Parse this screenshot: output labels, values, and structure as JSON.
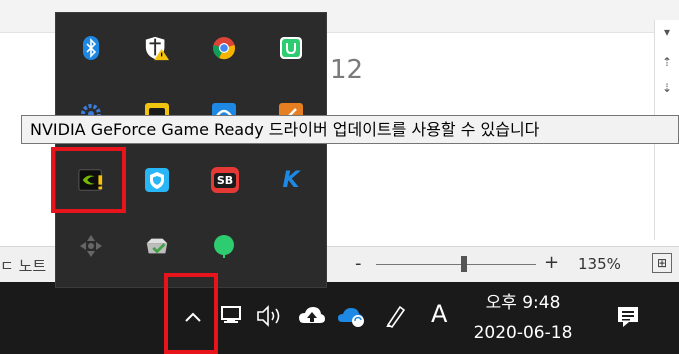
{
  "document": {
    "visible_number": "12",
    "status_left": "ㄷ 노트"
  },
  "status_bar": {
    "zoom_minus": "-",
    "zoom_plus": "+",
    "zoom_percent": "135%",
    "zoom_level": 0.55
  },
  "tooltip": {
    "text": "NVIDIA GeForce Game Ready 드라이버 업데이트를 사용할 수 있습니다"
  },
  "tray_icons": [
    {
      "name": "bluetooth-icon",
      "color": "#1e88e5"
    },
    {
      "name": "windows-security-warning-icon",
      "color": "#ffffff"
    },
    {
      "name": "chrome-icon",
      "color": "#f4b400"
    },
    {
      "name": "green-shield-app-icon",
      "color": "#2ecc71"
    },
    {
      "name": "gear-settings-icon",
      "color": "#3b7dd8"
    },
    {
      "name": "yellow-app-icon",
      "color": "#f1c40f"
    },
    {
      "name": "blue-app-icon",
      "color": "#1e88e5"
    },
    {
      "name": "orange-app-icon",
      "color": "#e67e22"
    },
    {
      "name": "nvidia-update-icon",
      "color": "#76b900"
    },
    {
      "name": "shield-vpn-icon",
      "color": "#29b6f6"
    },
    {
      "name": "sb-app-icon",
      "color": "#e53935",
      "label": "SB"
    },
    {
      "name": "k-app-icon",
      "color": "#1e88e5",
      "label": "K"
    },
    {
      "name": "gamepad-icon",
      "color": "#666666"
    },
    {
      "name": "checkmark-drive-icon",
      "color": "#43a047"
    },
    {
      "name": "green-circle-icon",
      "color": "#2ecc71"
    }
  ],
  "taskbar": {
    "chevron": "^",
    "ime": "A",
    "time": "오후 9:48",
    "date": "2020-06-18"
  },
  "colors": {
    "highlight": "#e8141b",
    "taskbar": "#1a1a1a",
    "flyout": "#2b2b2b"
  }
}
